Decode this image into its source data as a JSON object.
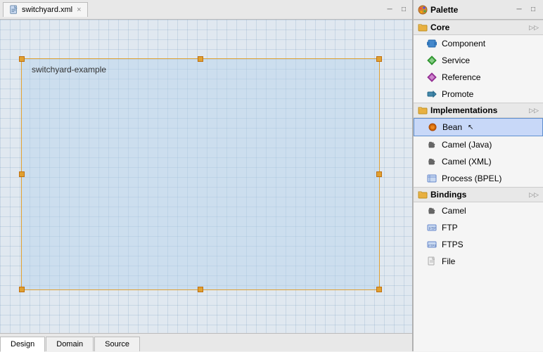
{
  "editor": {
    "tab_label": "switchyard.xml",
    "tab_close": "×",
    "canvas_label": "switchyard-example",
    "bottom_tabs": [
      {
        "label": "Design",
        "active": true
      },
      {
        "label": "Domain",
        "active": false
      },
      {
        "label": "Source",
        "active": false
      }
    ]
  },
  "palette": {
    "title": "Palette",
    "sections": [
      {
        "id": "core",
        "label": "Core",
        "items": [
          {
            "id": "component",
            "label": "Component",
            "icon": "component"
          },
          {
            "id": "service",
            "label": "Service",
            "icon": "service"
          },
          {
            "id": "reference",
            "label": "Reference",
            "icon": "reference"
          },
          {
            "id": "promote",
            "label": "Promote",
            "icon": "promote"
          }
        ]
      },
      {
        "id": "implementations",
        "label": "Implementations",
        "items": [
          {
            "id": "bean",
            "label": "Bean",
            "icon": "bean",
            "selected": true
          },
          {
            "id": "camel-java",
            "label": "Camel (Java)",
            "icon": "camel"
          },
          {
            "id": "camel-xml",
            "label": "Camel (XML)",
            "icon": "camel"
          },
          {
            "id": "process-bpel",
            "label": "Process (BPEL)",
            "icon": "process"
          }
        ]
      },
      {
        "id": "bindings",
        "label": "Bindings",
        "items": [
          {
            "id": "camel",
            "label": "Camel",
            "icon": "camel"
          },
          {
            "id": "ftp",
            "label": "FTP",
            "icon": "ftp"
          },
          {
            "id": "ftps",
            "label": "FTPS",
            "icon": "ftps"
          },
          {
            "id": "file",
            "label": "File",
            "icon": "file"
          }
        ]
      }
    ]
  }
}
